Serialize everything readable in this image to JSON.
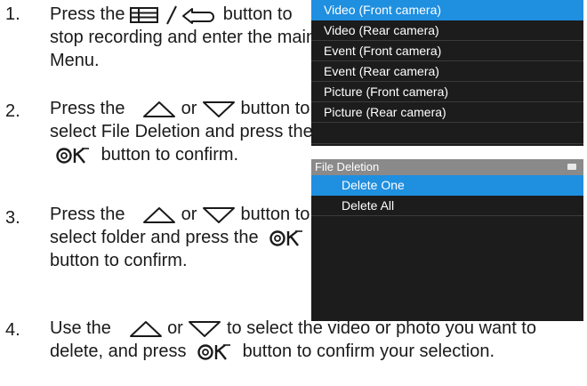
{
  "steps": [
    {
      "num": "1.",
      "before": "Press the",
      "after": "button to stop recording and enter the main Menu."
    },
    {
      "num": "2.",
      "before": "Press the",
      "or": "or",
      "after1": "button to select File Deletion and press the",
      "after2": "button to confirm."
    },
    {
      "num": "3.",
      "before": "Press the",
      "or": "or",
      "after1": "button to select folder and press the",
      "after2": "button to confirm."
    },
    {
      "num": "4.",
      "before": "Use the",
      "or": "or",
      "after1": "to select the video or photo you want to delete, and press",
      "after2": "button to confirm your selection."
    }
  ],
  "screen_top": {
    "items": [
      "Video (Front camera)",
      "Video (Rear camera)",
      "Event (Front camera)",
      "Event (Rear camera)",
      "Picture (Front camera)",
      "Picture (Rear camera)"
    ],
    "selected_index": 0
  },
  "screen_bottom": {
    "title": "File Deletion",
    "items": [
      "Delete One",
      "Delete All"
    ],
    "selected_index": 0
  },
  "icons": [
    "menu-icon",
    "back-icon",
    "up-triangle-icon",
    "down-triangle-icon",
    "ok-icon"
  ],
  "colors": {
    "highlight": "#1f8fe0",
    "screen_bg": "#1c1c1c",
    "header_bg": "#8a8a8a"
  }
}
